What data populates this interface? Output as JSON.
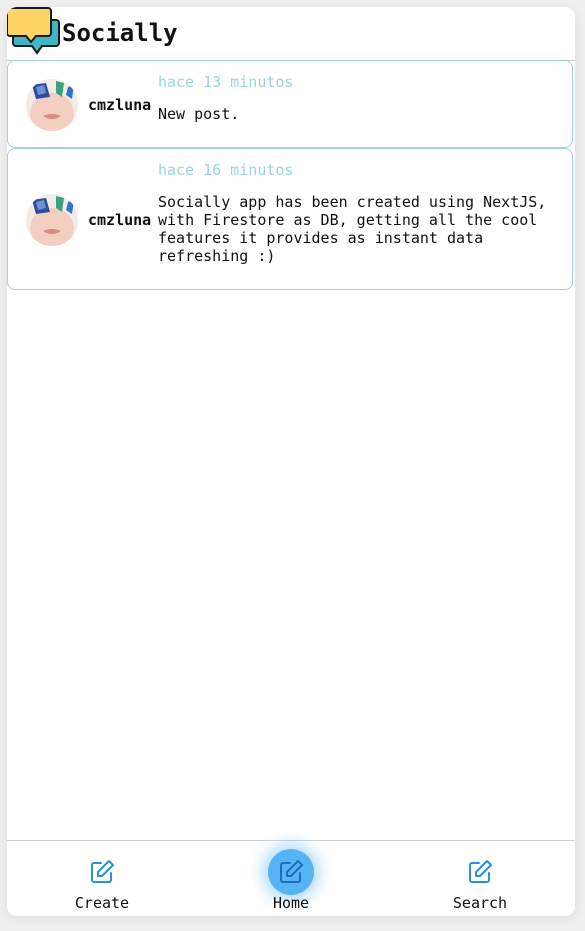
{
  "app": {
    "title": "Socially"
  },
  "posts": [
    {
      "username": "cmzluna",
      "time": "hace 13 minutos",
      "content": "New post."
    },
    {
      "username": "cmzluna",
      "time": "hace 16 minutos",
      "content": "Socially app has been created using NextJS,\nwith Firestore as DB, getting all the cool\nfeatures it provides as instant data\nrefreshing :)"
    }
  ],
  "nav": {
    "items": [
      {
        "label": "Create",
        "icon": "edit-icon"
      },
      {
        "label": "Home",
        "icon": "edit-icon",
        "active": true
      },
      {
        "label": "Search",
        "icon": "edit-icon"
      }
    ]
  },
  "colors": {
    "accent": "#56b4f5",
    "post_border": "#9fd2e3",
    "timestamp": "#9cd3e3",
    "logo_yellow": "#fdd365",
    "logo_teal": "#3fb6c8"
  }
}
